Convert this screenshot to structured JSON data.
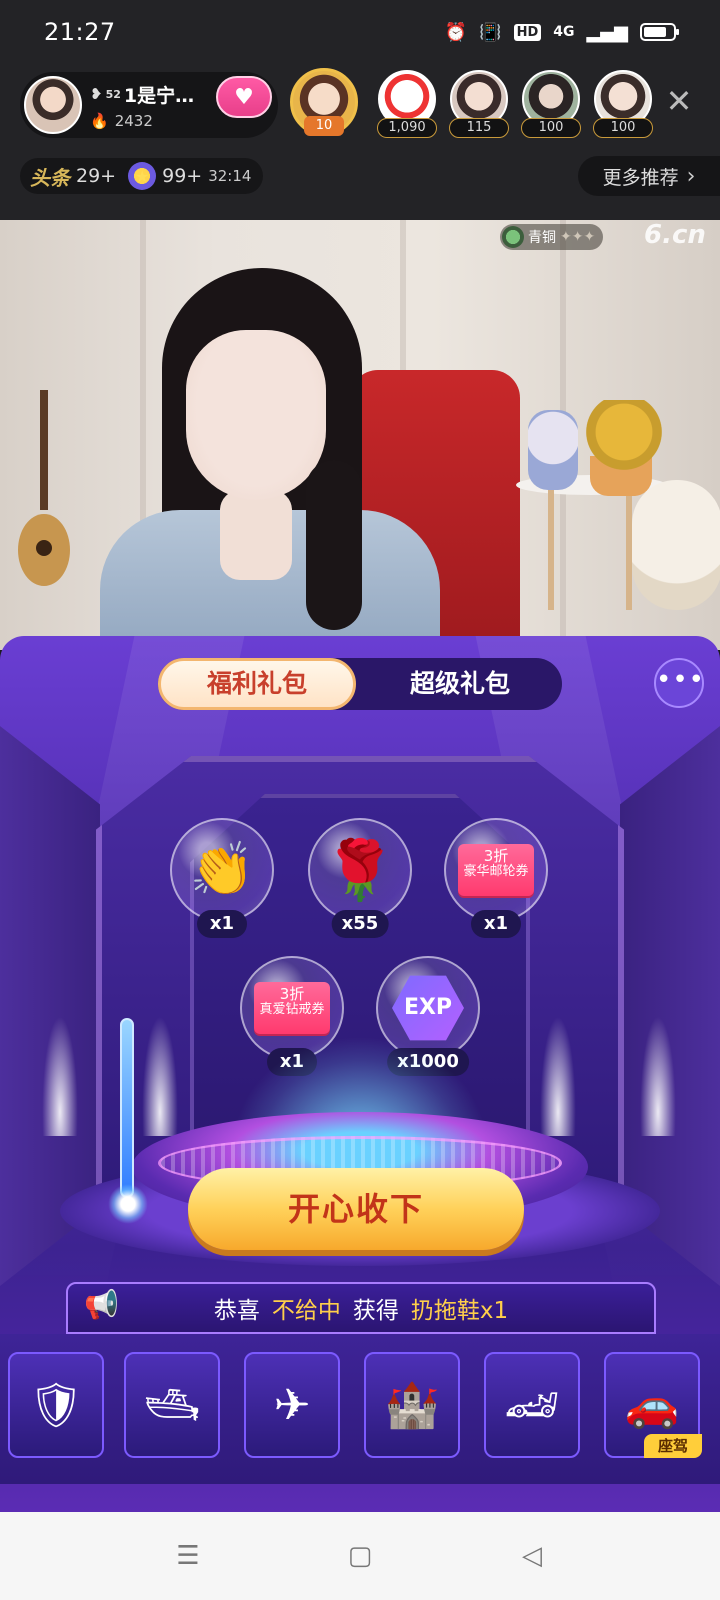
{
  "status_bar": {
    "time": "21:27",
    "network": "4G",
    "hd": "HD"
  },
  "host": {
    "name": "1是宁…",
    "level_tag": "52",
    "heat": "2432",
    "follow_icon": "heart-icon"
  },
  "rank_badge": {
    "value": "10"
  },
  "audience": [
    {
      "count": "1,090"
    },
    {
      "count": "115"
    },
    {
      "count": "100"
    },
    {
      "count": "100"
    }
  ],
  "tags": {
    "headline": "头条",
    "headline_count": "29+",
    "star_count": "99+",
    "timer": "32:14"
  },
  "more_recommend": {
    "label": "更多推荐"
  },
  "video": {
    "anchor_rank": "青铜",
    "watermark": "6.cn"
  },
  "panel": {
    "tabs": [
      {
        "label": "福利礼包",
        "active": true
      },
      {
        "label": "超级礼包",
        "active": false
      }
    ],
    "more_label": "•••",
    "gifts": [
      {
        "icon": "clapping-hands-icon",
        "qty": "x1"
      },
      {
        "icon": "rose-icon",
        "qty": "x55"
      },
      {
        "icon": "cruise-coupon-icon",
        "qty": "x1",
        "coupon_top": "3折",
        "coupon_bottom": "豪华邮轮券"
      },
      {
        "icon": "ring-coupon-icon",
        "qty": "x1",
        "coupon_top": "3折",
        "coupon_bottom": "真爱钻戒券"
      },
      {
        "icon": "exp-gem-icon",
        "qty": "x1000",
        "gem_label": "EXP"
      }
    ],
    "accept_label": "开心收下",
    "congrats": {
      "prefix": "恭喜",
      "user": "不给中",
      "verb": "获得",
      "item": "扔拖鞋x1"
    },
    "gift_row": [
      {
        "icon": "guard-badge-icon"
      },
      {
        "icon": "yacht-icon"
      },
      {
        "icon": "airplane-icon"
      },
      {
        "icon": "castle-icon"
      },
      {
        "icon": "red-sportscar-icon"
      },
      {
        "icon": "silver-sportscar-icon",
        "tag": "座驾"
      }
    ]
  },
  "colors": {
    "panel_top": "#6a3ed3",
    "accept_text": "#c23419",
    "gold_text": "#ffcf4a"
  }
}
